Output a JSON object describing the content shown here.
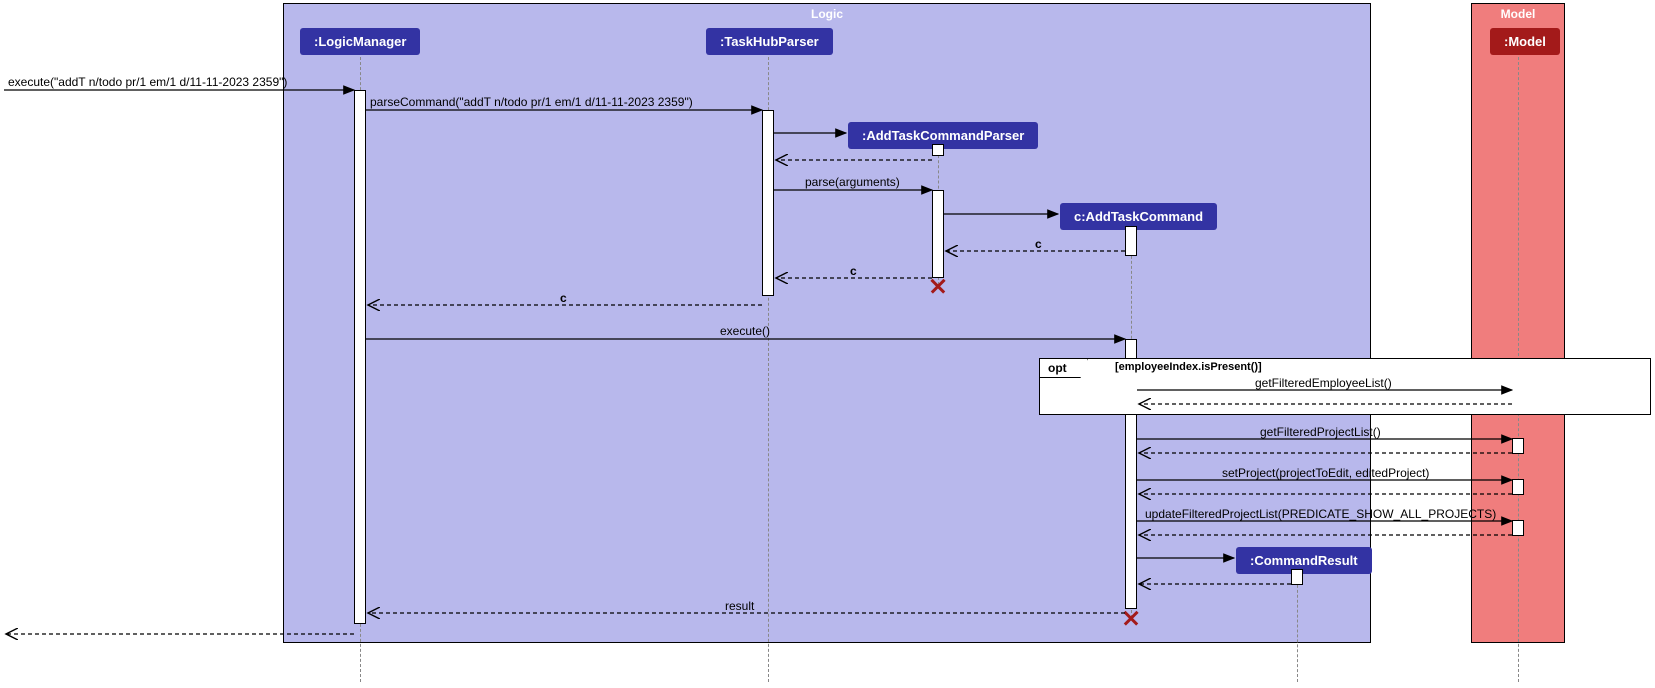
{
  "frames": {
    "logic": {
      "title": "Logic"
    },
    "model": {
      "title": "Model"
    }
  },
  "participants": {
    "logicManager": ":LogicManager",
    "taskHubParser": ":TaskHubParser",
    "addTaskCommandParser": ":AddTaskCommandParser",
    "addTaskCommand": "c:AddTaskCommand",
    "commandResult": ":CommandResult",
    "model": ":Model"
  },
  "messages": {
    "execute1": "execute(\"addT n/todo pr/1 em/1 d/11-11-2023 2359\")",
    "parseCommand": "parseCommand(\"addT n/todo pr/1 em/1 d/11-11-2023 2359\")",
    "parseArgs": "parse(arguments)",
    "returnC1": "c",
    "returnC2": "c",
    "returnC3": "c",
    "execute2": "execute()",
    "getFilteredEmployeeList": "getFilteredEmployeeList()",
    "getFilteredProjectList": "getFilteredProjectList()",
    "setProject": "setProject(projectToEdit, editedProject)",
    "updateFilteredProjectList": "updateFilteredProjectList(PREDICATE_SHOW_ALL_PROJECTS)",
    "result": "result"
  },
  "fragments": {
    "opt": {
      "label": "opt",
      "guard": "[employeeIndex.isPresent()]"
    }
  }
}
